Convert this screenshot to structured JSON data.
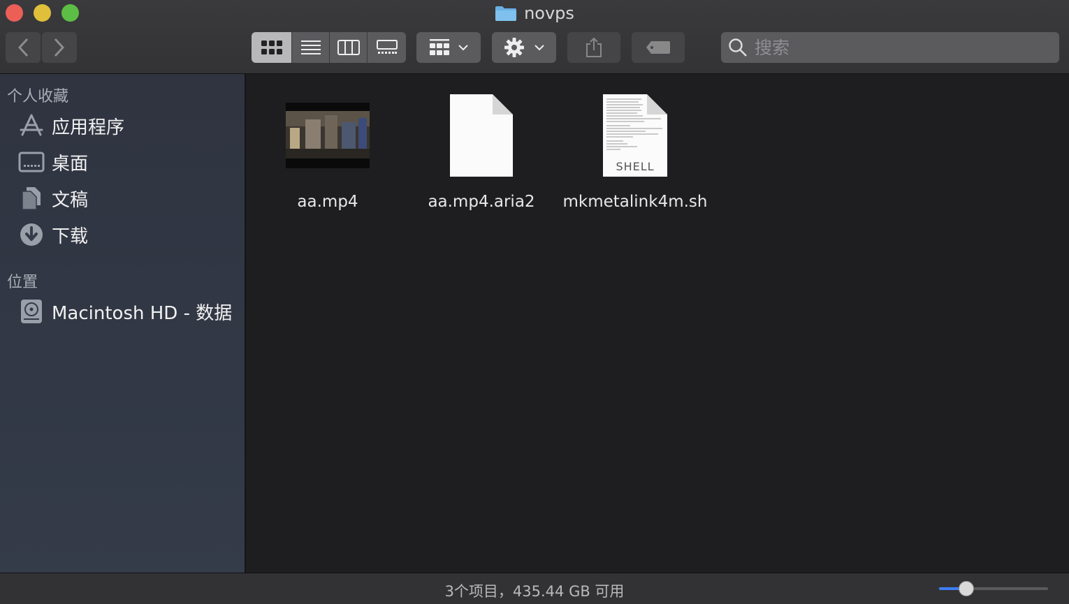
{
  "window": {
    "title": "novps"
  },
  "toolbar": {
    "view_modes": [
      "icon-view",
      "list-view",
      "column-view",
      "gallery-view"
    ],
    "active_view": "icon-view"
  },
  "search": {
    "placeholder": "搜索"
  },
  "sidebar": {
    "favorites_title": "个人收藏",
    "favorites": [
      {
        "label": "应用程序",
        "icon": "applications-icon"
      },
      {
        "label": "桌面",
        "icon": "desktop-icon"
      },
      {
        "label": "文稿",
        "icon": "documents-icon"
      },
      {
        "label": "下载",
        "icon": "downloads-icon"
      }
    ],
    "locations_title": "位置",
    "locations": [
      {
        "label": "Macintosh HD - 数据",
        "icon": "disk-icon"
      }
    ]
  },
  "files": [
    {
      "name": "aa.mp4",
      "kind": "video-thumbnail"
    },
    {
      "name": "aa.mp4.aria2",
      "kind": "blank-document"
    },
    {
      "name": "mkmetalink4m.sh",
      "kind": "shell-script",
      "badge": "SHELL"
    }
  ],
  "status": {
    "text": "3个项目，435.44 GB 可用",
    "icon_size_fraction": 0.25
  },
  "colors": {
    "accent": "#3d7ff5",
    "folder": "#6ab0e6"
  }
}
